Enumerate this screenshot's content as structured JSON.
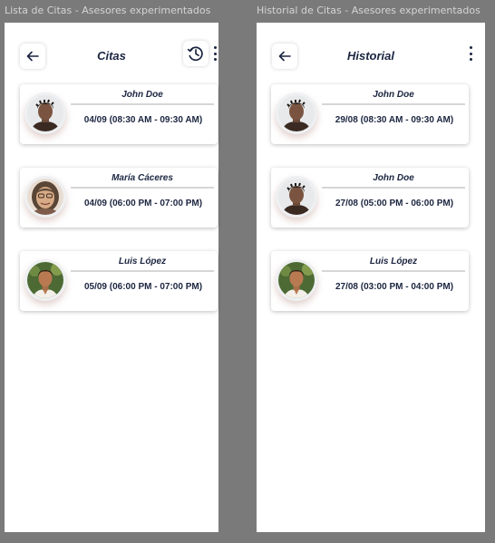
{
  "frames": {
    "left": {
      "label": "Lista de Citas - Asesores experimentados",
      "title": "Citas",
      "cards": [
        {
          "name": "John Doe",
          "time": "04/09 (08:30 AM - 09:30 AM)"
        },
        {
          "name": "María Cáceres",
          "time": "04/09 (06:00 PM - 07:00 PM)"
        },
        {
          "name": "Luis López",
          "time": "05/09 (06:00 PM - 07:00 PM)"
        }
      ]
    },
    "right": {
      "label": "Historial de Citas - Asesores experimentados",
      "title": "Historial",
      "cards": [
        {
          "name": "John Doe",
          "time": "29/08 (08:30 AM - 09:30 AM)"
        },
        {
          "name": "John Doe",
          "time": "27/08 (05:00 PM - 06:00 PM)"
        },
        {
          "name": "Luis López",
          "time": "27/08 (03:00 PM - 04:00 PM)"
        }
      ]
    }
  },
  "icons": {
    "back": "back-arrow-icon",
    "history": "history-clock-icon",
    "more": "more-vertical-icon"
  },
  "colors": {
    "text_primary": "#1b2540",
    "canvas": "#7a7a7a",
    "surface": "#ffffff",
    "divider": "#d6d6d6"
  }
}
